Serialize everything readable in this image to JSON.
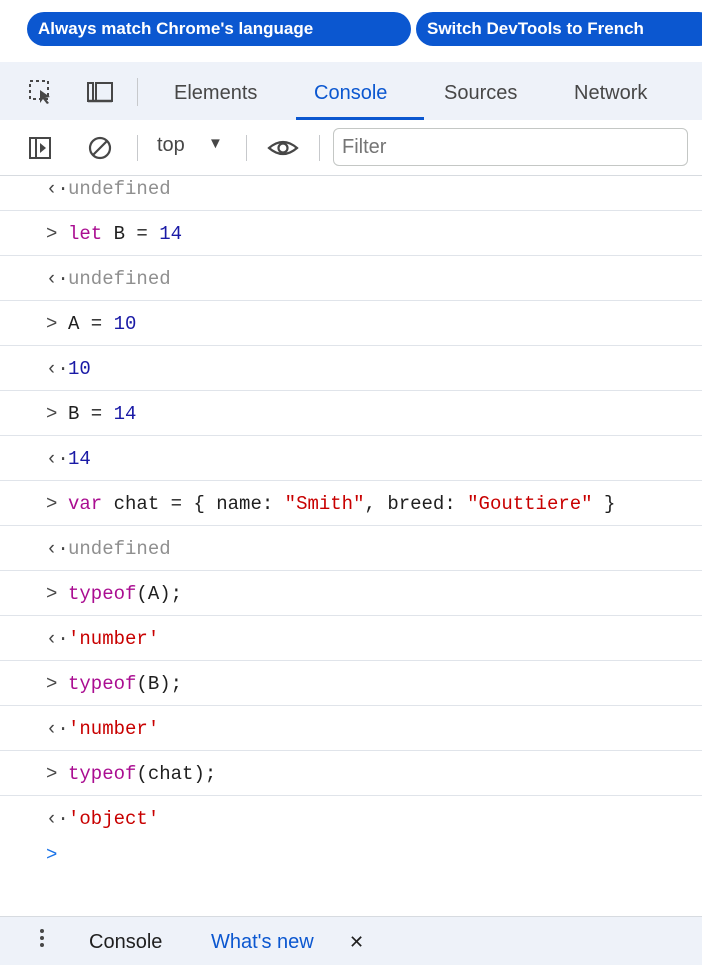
{
  "banner": {
    "match_language": "Always match Chrome's language",
    "switch_french": "Switch DevTools to French"
  },
  "tabs": {
    "elements": "Elements",
    "console": "Console",
    "sources": "Sources",
    "network": "Network",
    "active": "Console"
  },
  "toolbar": {
    "context": "top",
    "context_arrow": "▼",
    "filter_placeholder": "Filter"
  },
  "console": {
    "rows": [
      {
        "type": "output",
        "prompt": "‹·",
        "text": "undefined"
      },
      {
        "type": "input",
        "prompt": ">",
        "text": "let B = 14"
      },
      {
        "type": "output",
        "prompt": "‹·",
        "text": "undefined"
      },
      {
        "type": "input",
        "prompt": ">",
        "text": "A = 10"
      },
      {
        "type": "output",
        "prompt": "‹·",
        "text": "10"
      },
      {
        "type": "input",
        "prompt": ">",
        "text": "B = 14"
      },
      {
        "type": "output",
        "prompt": "‹·",
        "text": "14"
      },
      {
        "type": "input",
        "prompt": ">",
        "text": "var chat = { name: \"Smith\", breed: \"Gouttiere\" }"
      },
      {
        "type": "output",
        "prompt": "‹·",
        "text": "undefined"
      },
      {
        "type": "input",
        "prompt": ">",
        "text": "typeof(A);"
      },
      {
        "type": "output",
        "prompt": "‹·",
        "text": "'number'"
      },
      {
        "type": "input",
        "prompt": ">",
        "text": "typeof(B);"
      },
      {
        "type": "output",
        "prompt": "‹·",
        "text": "'number'"
      },
      {
        "type": "input",
        "prompt": ">",
        "text": "typeof(chat);"
      },
      {
        "type": "output",
        "prompt": "‹·",
        "text": "'object'"
      }
    ],
    "input_prompt": ">"
  },
  "drawer": {
    "console": "Console",
    "whats_new": "What's new",
    "close": "✕"
  },
  "colors": {
    "accent": "#0b57d0",
    "keyword": "#aa0d91",
    "number": "#1a1aa6",
    "string": "#c80000"
  },
  "icons": [
    "inspect-element-icon",
    "device-toolbar-icon",
    "sidebar-toggle-icon",
    "clear-console-icon",
    "eye-icon",
    "kebab-menu-icon",
    "close-icon"
  ]
}
